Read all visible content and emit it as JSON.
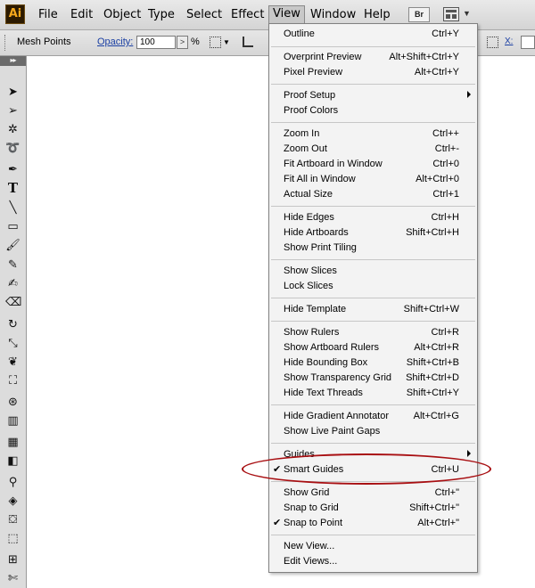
{
  "menubar": {
    "logo": "Ai",
    "items": [
      "File",
      "Edit",
      "Object",
      "Type",
      "Select",
      "Effect",
      "View",
      "Window",
      "Help"
    ],
    "bridge_label": "Br"
  },
  "toolbar": {
    "mode_label": "Mesh Points",
    "opacity_label": "Opacity:",
    "opacity_value": "100",
    "percent": "%",
    "x_label": "X:"
  },
  "tools": {
    "collapse_glyph": "▸▸"
  },
  "view_menu": {
    "items": [
      {
        "label": "Outline",
        "shortcut": "Ctrl+Y"
      },
      {
        "label": "Overprint Preview",
        "shortcut": "Alt+Shift+Ctrl+Y"
      },
      {
        "label": "Pixel Preview",
        "shortcut": "Alt+Ctrl+Y"
      },
      {
        "label": "Proof Setup",
        "shortcut": "",
        "submenu": true
      },
      {
        "label": "Proof Colors",
        "shortcut": ""
      },
      {
        "label": "Zoom In",
        "shortcut": "Ctrl++"
      },
      {
        "label": "Zoom Out",
        "shortcut": "Ctrl+-"
      },
      {
        "label": "Fit Artboard in Window",
        "shortcut": "Ctrl+0"
      },
      {
        "label": "Fit All in Window",
        "shortcut": "Alt+Ctrl+0"
      },
      {
        "label": "Actual Size",
        "shortcut": "Ctrl+1"
      },
      {
        "label": "Hide Edges",
        "shortcut": "Ctrl+H"
      },
      {
        "label": "Hide Artboards",
        "shortcut": "Shift+Ctrl+H"
      },
      {
        "label": "Show Print Tiling",
        "shortcut": ""
      },
      {
        "label": "Show Slices",
        "shortcut": ""
      },
      {
        "label": "Lock Slices",
        "shortcut": ""
      },
      {
        "label": "Hide Template",
        "shortcut": "Shift+Ctrl+W"
      },
      {
        "label": "Show Rulers",
        "shortcut": "Ctrl+R"
      },
      {
        "label": "Show Artboard Rulers",
        "shortcut": "Alt+Ctrl+R"
      },
      {
        "label": "Hide Bounding Box",
        "shortcut": "Shift+Ctrl+B"
      },
      {
        "label": "Show Transparency Grid",
        "shortcut": "Shift+Ctrl+D"
      },
      {
        "label": "Hide Text Threads",
        "shortcut": "Shift+Ctrl+Y"
      },
      {
        "label": "Hide Gradient Annotator",
        "shortcut": "Alt+Ctrl+G"
      },
      {
        "label": "Show Live Paint Gaps",
        "shortcut": ""
      },
      {
        "label": "Guides",
        "shortcut": "",
        "submenu": true
      },
      {
        "label": "Smart Guides",
        "shortcut": "Ctrl+U",
        "checked": true
      },
      {
        "label": "Show Grid",
        "shortcut": "Ctrl+\""
      },
      {
        "label": "Snap to Grid",
        "shortcut": "Shift+Ctrl+\""
      },
      {
        "label": "Snap to Point",
        "shortcut": "Alt+Ctrl+\"",
        "checked": true
      },
      {
        "label": "New View...",
        "shortcut": ""
      },
      {
        "label": "Edit Views...",
        "shortcut": ""
      }
    ],
    "check_glyph": "✔"
  },
  "colors": {
    "highlight_circle": "#a80f12",
    "link": "#1a3fa3"
  }
}
